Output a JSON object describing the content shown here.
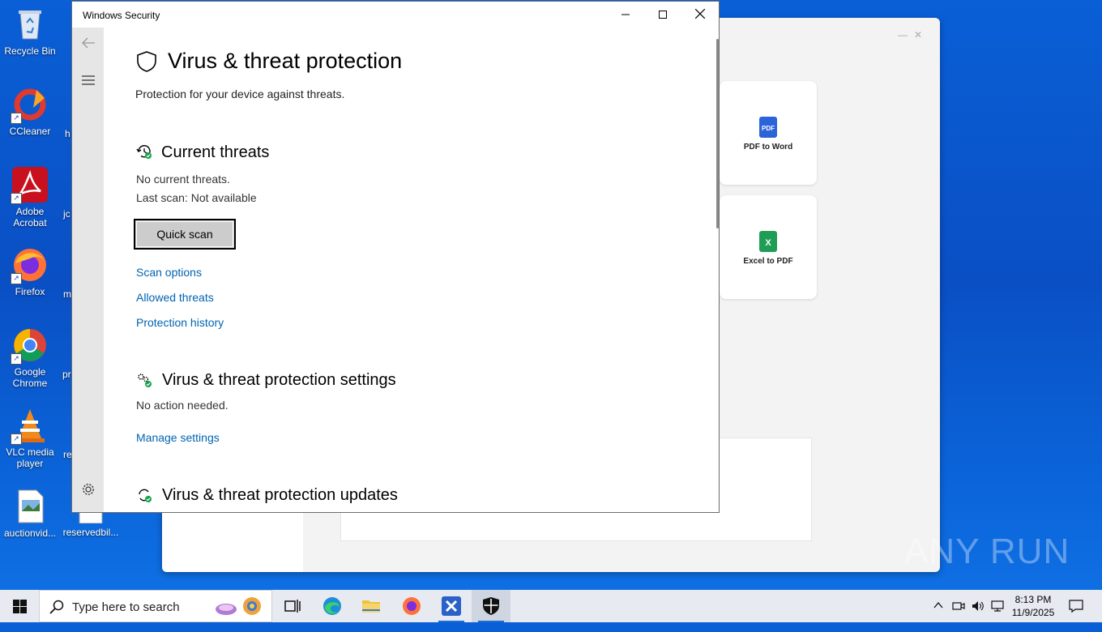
{
  "desktop": {
    "icons": [
      {
        "label": "Recycle Bin"
      },
      {
        "label": "CCleaner"
      },
      {
        "label": "Adobe Acrobat"
      },
      {
        "label": "Firefox"
      },
      {
        "label": "Google Chrome"
      },
      {
        "label": "VLC media player"
      },
      {
        "label": "auctionvid..."
      },
      {
        "label": "reservedbil..."
      }
    ],
    "partial_labels": [
      "h",
      "jc",
      "m",
      "pr",
      "re"
    ]
  },
  "bg_app": {
    "cards": [
      {
        "label": "PDF to Word",
        "color": "#2b63d9",
        "badge": "PDF"
      },
      {
        "label": "Excel to PDF",
        "color": "#1f9d55",
        "badge": "X"
      }
    ]
  },
  "window": {
    "title": "Windows Security",
    "page_title": "Virus & threat protection",
    "page_subtitle": "Protection for your device against threats.",
    "current_threats": {
      "heading": "Current threats",
      "status": "No current threats.",
      "last_scan": "Last scan: Not available",
      "quick_scan_label": "Quick scan",
      "links": [
        "Scan options",
        "Allowed threats",
        "Protection history"
      ]
    },
    "settings": {
      "heading": "Virus & threat protection settings",
      "status": "No action needed.",
      "link": "Manage settings"
    },
    "updates": {
      "heading": "Virus & threat protection updates"
    }
  },
  "taskbar": {
    "search_placeholder": "Type here to search",
    "time": "8:13 PM",
    "date": "11/9/2025"
  },
  "watermark": "ANY RUN",
  "colors": {
    "link": "#0063b1",
    "accent": "#1a6fd4",
    "status_ok": "#16a34a"
  }
}
